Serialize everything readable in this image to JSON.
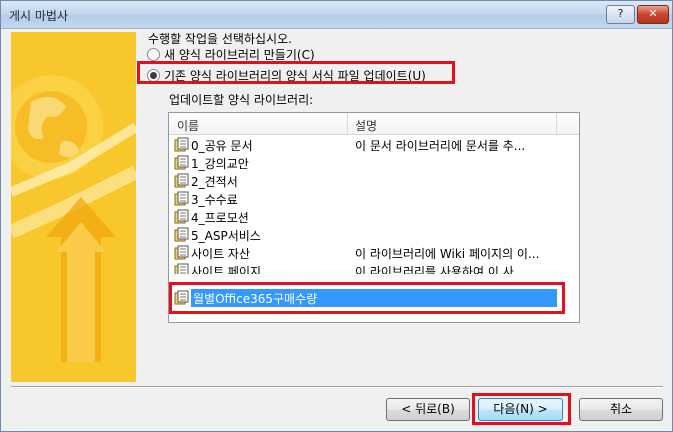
{
  "window": {
    "title": "게시 마법사",
    "help_label": "?",
    "close_label": "✕"
  },
  "instruction": "수행할 작업을 선택하십시오.",
  "options": [
    {
      "label": "새 양식 라이브러리 만들기(C)",
      "selected": false
    },
    {
      "label": "기존 양식 라이브러리의 양식 서식 파일 업데이트(U)",
      "selected": true
    }
  ],
  "library_list": {
    "label": "업데이트할 양식 라이브러리:",
    "columns": [
      "이름",
      "설명"
    ],
    "rows": [
      {
        "name": "0_공유 문서",
        "description": "이 문서 라이브러리에 문서를 추..."
      },
      {
        "name": "1_강의교안",
        "description": ""
      },
      {
        "name": "2_견적서",
        "description": ""
      },
      {
        "name": "3_수수료",
        "description": ""
      },
      {
        "name": "4_프로모션",
        "description": ""
      },
      {
        "name": "5_ASP서비스",
        "description": ""
      },
      {
        "name": "사이트 자산",
        "description": "이 라이브러리에 Wiki 페이지의 이..."
      },
      {
        "name": "사이트 페이지",
        "description": "이 라이브러리를 사용하여 이 사..."
      }
    ],
    "selected_row": {
      "name": "월별Office365구매수량"
    }
  },
  "buttons": {
    "back": "< 뒤로(B)",
    "next": "다음(N) >",
    "cancel": "취소"
  },
  "colors": {
    "highlight_box": "#e1101a",
    "selection": "#3399ff",
    "side_banner": "#f7c21a"
  },
  "icons": {
    "library": "form-library-icon",
    "side": "publish-wizard-banner"
  }
}
